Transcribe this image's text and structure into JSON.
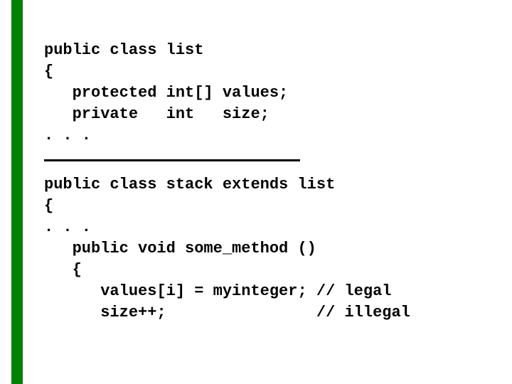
{
  "code_block_1": {
    "l1": "public class list",
    "l2": "{",
    "l3": "   protected int[] values;",
    "l4": "   private   int   size;",
    "l5": ". . ."
  },
  "code_block_2": {
    "l1": "public class stack extends list",
    "l2": "{",
    "l3": ". . .",
    "l4": "   public void some_method ()",
    "l5": "   {",
    "l6": "      values[i] = myinteger; // legal",
    "l7": "      size++;                // illegal"
  },
  "colors": {
    "accent_green": "#008000",
    "text": "#000000",
    "background": "#ffffff"
  }
}
